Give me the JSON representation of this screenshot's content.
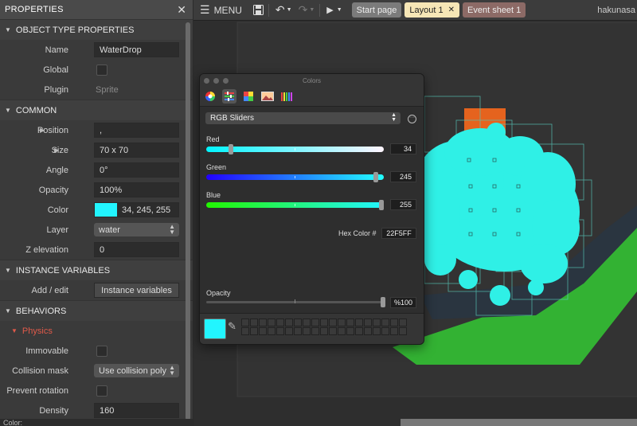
{
  "properties": {
    "title": "PROPERTIES",
    "close_glyph": "✕",
    "sections": {
      "object_type": "OBJECT TYPE PROPERTIES",
      "common": "COMMON",
      "instance_vars": "INSTANCE VARIABLES",
      "behaviors": "BEHAVIORS"
    },
    "name_label": "Name",
    "name_value": "WaterDrop",
    "global_label": "Global",
    "plugin_label": "Plugin",
    "plugin_value": "Sprite",
    "position_label": "Position",
    "position_value": ",",
    "size_label": "Size",
    "size_value": "70 x 70",
    "angle_label": "Angle",
    "angle_value": "0°",
    "opacity_label": "Opacity",
    "opacity_value": "100%",
    "color_label": "Color",
    "color_value": "34, 245, 255",
    "layer_label": "Layer",
    "layer_value": "water",
    "zelev_label": "Z elevation",
    "zelev_value": "0",
    "addedit_label": "Add / edit",
    "instvars_button": "Instance variables",
    "behavior_name": "Physics",
    "immovable_label": "Immovable",
    "collision_label": "Collision mask",
    "collision_value": "Use collision poly",
    "prevent_rot_label": "Prevent rotation",
    "density_label": "Density",
    "density_value": "160",
    "footer": "Color:"
  },
  "topbar": {
    "menu": "MENU",
    "tabs": [
      {
        "label": "Start page"
      },
      {
        "label": "Layout 1",
        "close": "✕"
      },
      {
        "label": "Event sheet 1"
      }
    ],
    "user": "hakunasa"
  },
  "colors_dialog": {
    "title": "Colors",
    "mode": "RGB Sliders",
    "red_label": "Red",
    "red_value": "34",
    "green_label": "Green",
    "green_value": "245",
    "blue_label": "Blue",
    "blue_value": "255",
    "hex_label": "Hex Color #",
    "hex_value": "22F5FF",
    "opacity_label": "Opacity",
    "opacity_value": "%100",
    "current_color": "#22f5ff"
  },
  "colors": {
    "water": "#2ff0e6",
    "ground_green": "#33b233",
    "accent_orange": "#e5631e",
    "physics_red": "#e05a4a"
  }
}
